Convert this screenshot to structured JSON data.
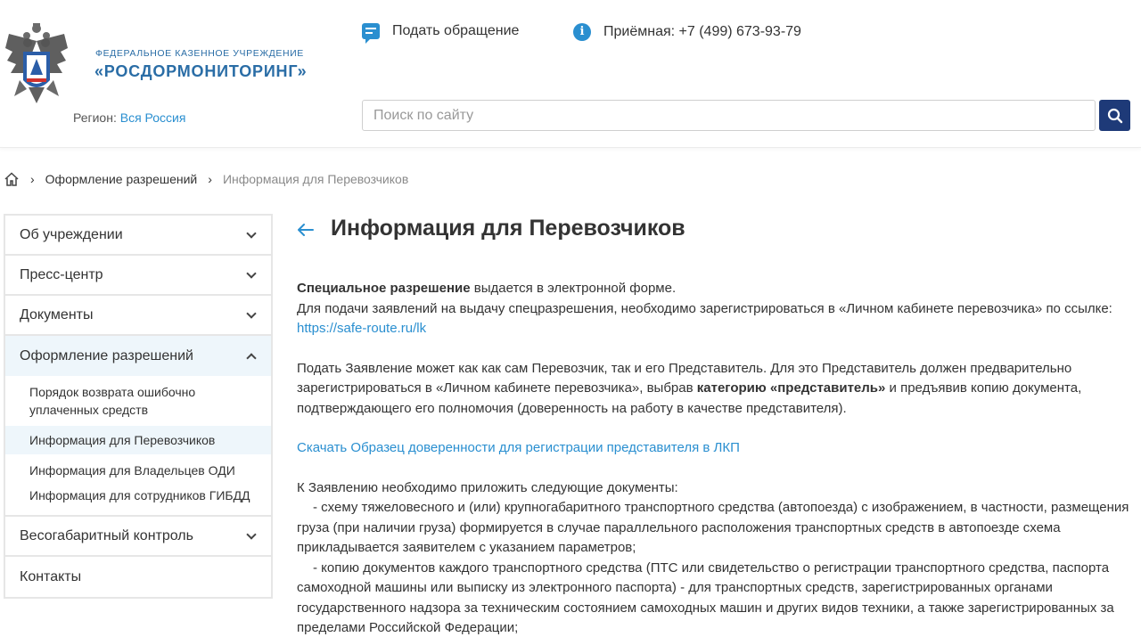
{
  "header": {
    "org_subtitle": "Федеральное казенное учреждение",
    "org_name": "«РОСДОРМОНИТОРИНГ»",
    "region_label": "Регион:",
    "region_value": "Вся Россия",
    "appeal_label": "Подать обращение",
    "phone_label": "Приёмная: +7 (499) 673-93-79",
    "search_placeholder": "Поиск по сайту",
    "colors": {
      "accent": "#2a8fd0",
      "brand": "#2a6da6",
      "search_button": "#1e3a78"
    }
  },
  "breadcrumb": {
    "items": [
      "Оформление разрешений",
      "Информация для Перевозчиков"
    ]
  },
  "sidebar": {
    "items": [
      {
        "label": "Об учреждении"
      },
      {
        "label": "Пресс-центр"
      },
      {
        "label": "Документы"
      },
      {
        "label": "Оформление разрешений"
      },
      {
        "label": "Весогабаритный контроль"
      },
      {
        "label": "Контакты"
      }
    ],
    "submenu": [
      {
        "label": "Порядок возврата ошибочно уплаченных средств"
      },
      {
        "label": "Информация для Перевозчиков"
      },
      {
        "label": "Информация для Владельцев ОДИ"
      },
      {
        "label": "Информация для сотрудников ГИБДД"
      }
    ]
  },
  "main": {
    "title": "Информация для Перевозчиков",
    "p1_bold": "Специальное разрешение",
    "p1_text": " выдается в электронной форме.",
    "p1_line2": "Для подачи заявлений на выдачу спецразрешения, необходимо зарегистрироваться в «Личном кабинете перевозчика» по ссылке:",
    "p1_link": "https://safe-route.ru/lk",
    "p2_text1": "Подать Заявление может как как сам Перевозчик, так и его Представитель. Для это Представитель должен предварительно зарегистрироваться в «Личном кабинете перевозчика», выбрав ",
    "p2_bold": "категорию «представитель»",
    "p2_text2": " и предъявив копию документа, подтверждающего его полномочия (доверенность на работу в качестве представителя).",
    "download_link": "Скачать Образец доверенности для регистрации представителя в ЛКП",
    "docs_intro": "К Заявлению необходимо приложить следующие документы:",
    "doc1": "- схему тяжеловесного и (или) крупногабаритного транспортного средства (автопоезда) с изображением, в частности, размещения груза (при наличии груза) формируется в случае параллельного расположения транспортных средств в автопоезде схема прикладывается заявителем с указанием параметров;",
    "doc2": "- копию документов каждого транспортного средства (ПТС или свидетельство о регистрации транспортного средства, паспорта самоходной машины или выписку из электронного паспорта) - для транспортных средств, зарегистрированных органами государственного надзора за техническим состоянием самоходных машин и других видов техники, а также зарегистрированных за пределами Российской Федерации;"
  }
}
